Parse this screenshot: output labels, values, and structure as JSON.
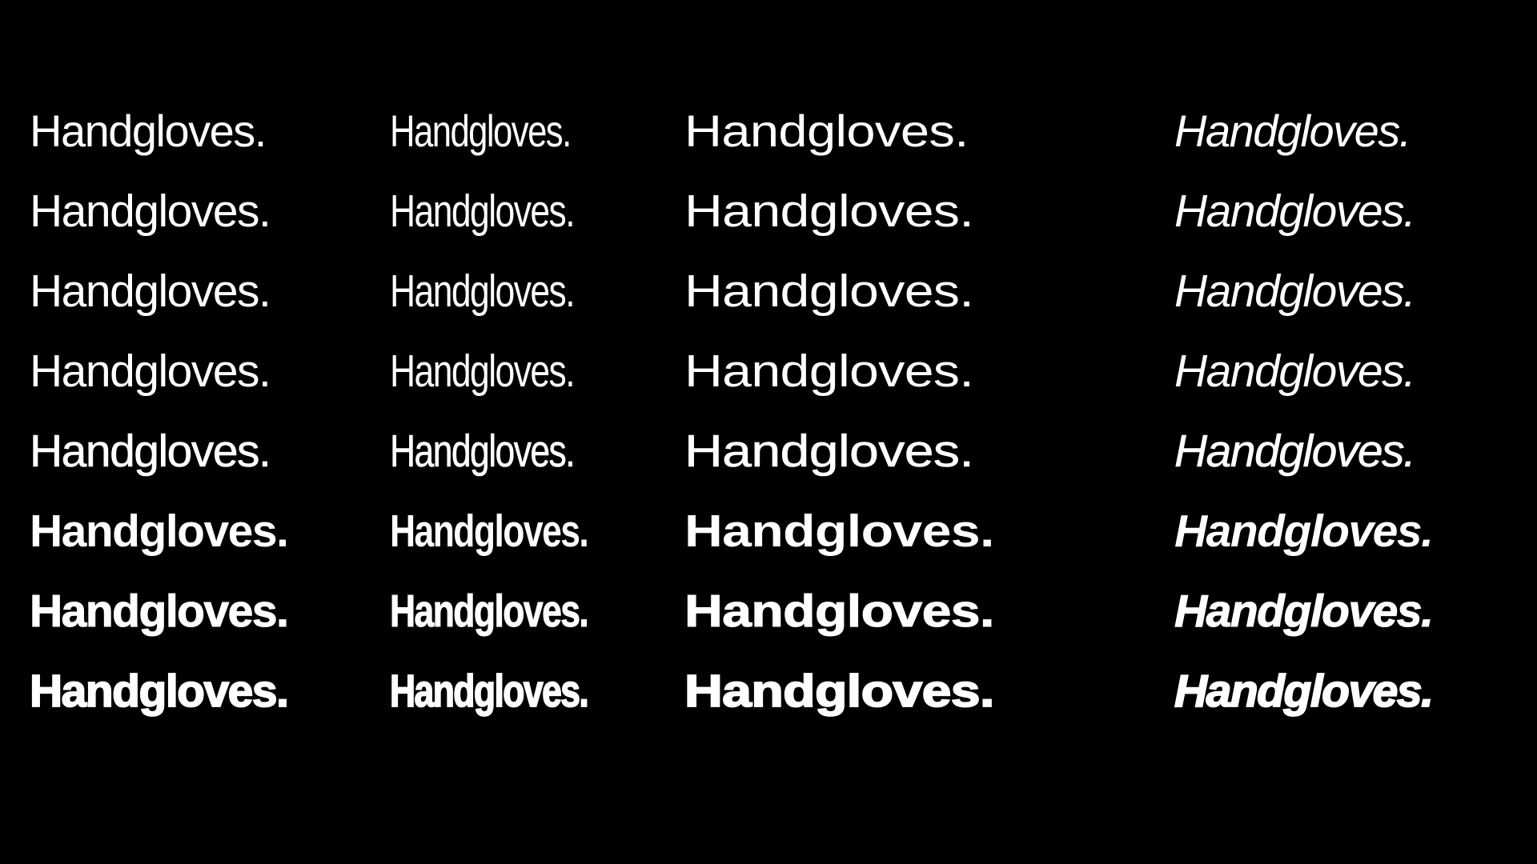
{
  "specimen": {
    "sample_text": "Handgloves.",
    "columns": [
      {
        "id": "regular",
        "rows": [
          "Handgloves.",
          "Handgloves.",
          "Handgloves.",
          "Handgloves.",
          "Handgloves.",
          "Handgloves.",
          "Handgloves.",
          "Handgloves."
        ]
      },
      {
        "id": "condensed",
        "rows": [
          "Handgloves.",
          "Handgloves.",
          "Handgloves.",
          "Handgloves.",
          "Handgloves.",
          "Handgloves.",
          "Handgloves.",
          "Handgloves."
        ]
      },
      {
        "id": "extended",
        "rows": [
          "Handgloves.",
          "Handgloves.",
          "Handgloves.",
          "Handgloves.",
          "Handgloves.",
          "Handgloves.",
          "Handgloves.",
          "Handgloves."
        ]
      },
      {
        "id": "italic",
        "rows": [
          "Handgloves.",
          "Handgloves.",
          "Handgloves.",
          "Handgloves.",
          "Handgloves.",
          "Handgloves.",
          "Handgloves.",
          "Handgloves."
        ]
      }
    ]
  },
  "colors": {
    "background": "#000000",
    "text": "#ffffff"
  }
}
